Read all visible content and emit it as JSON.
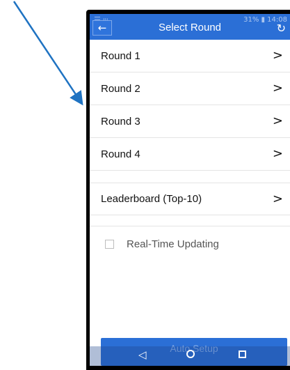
{
  "header": {
    "title": "Select Round",
    "status_time": "31% ▮ 14:08",
    "back_icon": "back-arrow-icon",
    "refresh_icon": "refresh-icon"
  },
  "rounds": [
    {
      "label": "Round 1"
    },
    {
      "label": "Round 2"
    },
    {
      "label": "Round 3"
    },
    {
      "label": "Round 4"
    }
  ],
  "leaderboard": {
    "label": "Leaderboard (Top-10)"
  },
  "realtime": {
    "label": "Real-Time Updating",
    "checked": false
  },
  "footer": {
    "auto_setup_label": "Auto Setup"
  },
  "colors": {
    "accent": "#2b6fd6",
    "annotation_arrow": "#1f73c2"
  }
}
